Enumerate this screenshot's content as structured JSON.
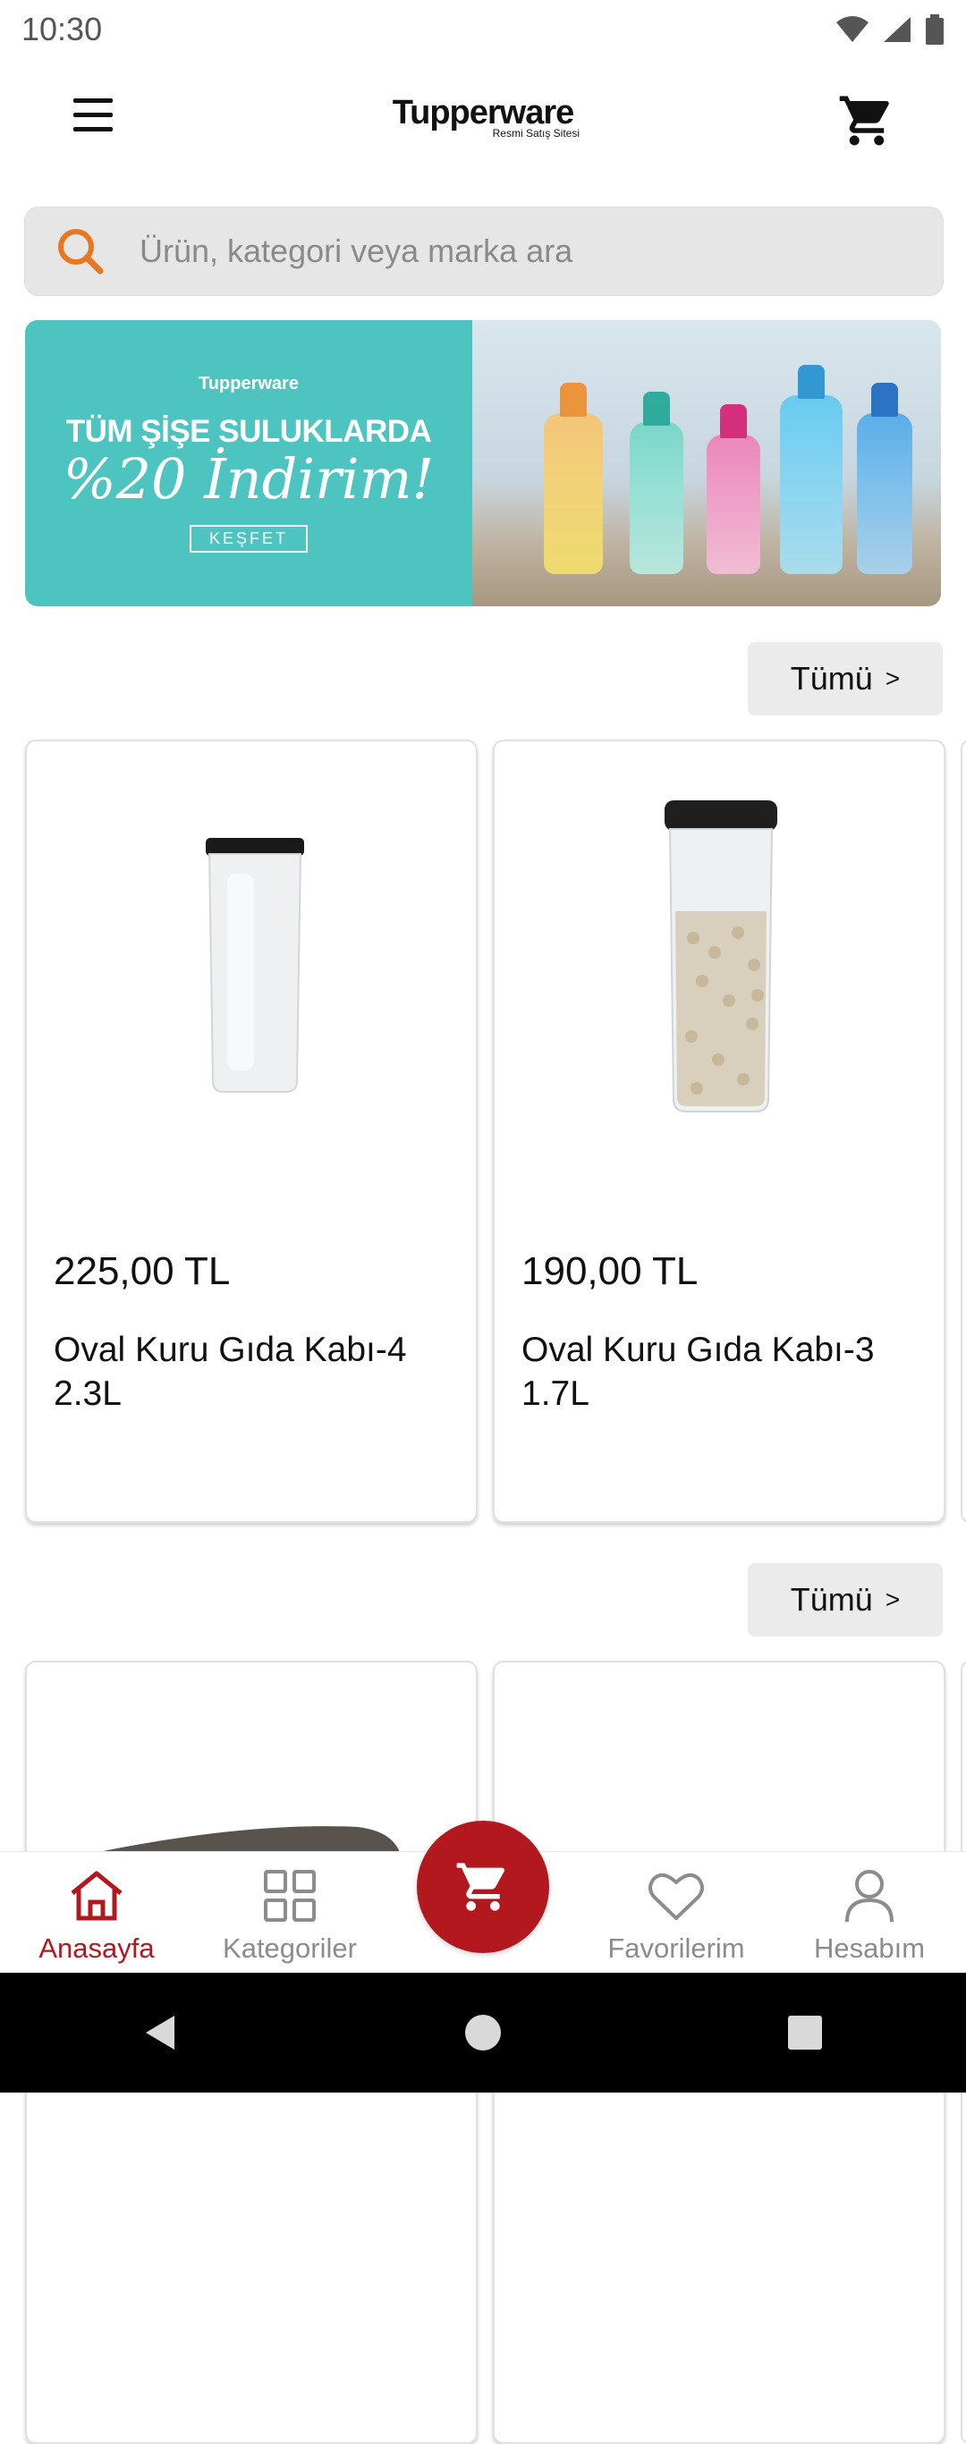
{
  "status_bar": {
    "time": "10:30"
  },
  "header": {
    "logo": "Tupperware",
    "logo_sub": "Resmi Satış Sitesi"
  },
  "search": {
    "placeholder": "Ürün, kategori veya marka ara"
  },
  "banner": {
    "brand": "Tupperware",
    "line1": "TÜM ŞİŞE SULUKLARDA",
    "line2": "%20 İndirim!",
    "cta": "KEŞFET",
    "bottle_colors": [
      "#f5a623",
      "#2fb8a7",
      "#e23c8c",
      "#27a6d9",
      "#1c79d0"
    ]
  },
  "sections": [
    {
      "see_all": "Tümü",
      "products": [
        {
          "price": "225,00 TL",
          "name": "Oval Kuru Gıda Kabı-4 2.3L"
        },
        {
          "price": "190,00 TL",
          "name": "Oval Kuru Gıda Kabı-3 1.7L"
        }
      ]
    },
    {
      "see_all": "Tümü"
    }
  ],
  "bottom_nav": {
    "items": [
      {
        "label": "Anasayfa",
        "icon": "home-icon",
        "active": true
      },
      {
        "label": "Kategoriler",
        "icon": "grid-icon"
      },
      {
        "label": "Favorilerim",
        "icon": "heart-icon"
      },
      {
        "label": "Hesabım",
        "icon": "person-icon"
      }
    ],
    "fab_icon": "cart-icon"
  },
  "colors": {
    "accent": "#b3181e",
    "search_icon": "#e87722",
    "banner_bg": "#4ec4c0"
  }
}
